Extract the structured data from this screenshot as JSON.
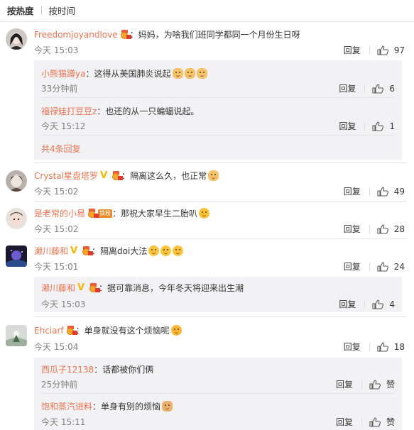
{
  "sort": {
    "hot": "按热度",
    "time": "按时间"
  },
  "comments": [
    {
      "name": "Freedomjoyandlove",
      "text": "妈妈，为啥我们班同学都同一个月份生日呀",
      "time": "今天 15:03",
      "reply": "回复",
      "likes": "97",
      "replies": [
        {
          "name": "小熊猫蹲ya",
          "text": "这得从美国肺炎说起",
          "time": "33分钟前",
          "reply": "回复",
          "likes": "6"
        },
        {
          "name": "福禄娃打豆豆z",
          "text": "也还的从一只蝙蝠说起。",
          "time": "今天 15:12",
          "reply": "回复",
          "likes": "1"
        }
      ],
      "more": "共4条回复"
    },
    {
      "name": "Crystal星盘塔罗",
      "text": "隔离这么久，也正常",
      "time": "今天 15:02",
      "reply": "回复",
      "likes": "49"
    },
    {
      "name": "是老常的小易",
      "fan_badge": "铁粉",
      "text": "那祝大家早生二胎叭",
      "time": "今天 15:02",
      "reply": "回复",
      "likes": "28"
    },
    {
      "name": "濑川藤和",
      "text": "隔离doi大法",
      "time": "今天 15:01",
      "reply": "回复",
      "likes": "24",
      "replies": [
        {
          "name": "濑川藤和",
          "text": "据可靠消息，今年冬天将迎来出生潮",
          "time": "今天 15:03",
          "reply": "回复",
          "likes": "4"
        }
      ]
    },
    {
      "name": "Ehciarf",
      "text": "单身就没有这个烦恼呢",
      "time": "今天 15:04",
      "reply": "回复",
      "likes": "18",
      "replies": [
        {
          "name": "西瓜子12138",
          "text": "话都被你们俩",
          "time": "25分钟前",
          "reply": "回复",
          "likes": "赞"
        },
        {
          "name": "饱和蒸汽进料",
          "text": "单身有别的烦恼",
          "time": "今天 15:11",
          "reply": "回复",
          "likes": "赞"
        }
      ]
    }
  ],
  "colon": "："
}
